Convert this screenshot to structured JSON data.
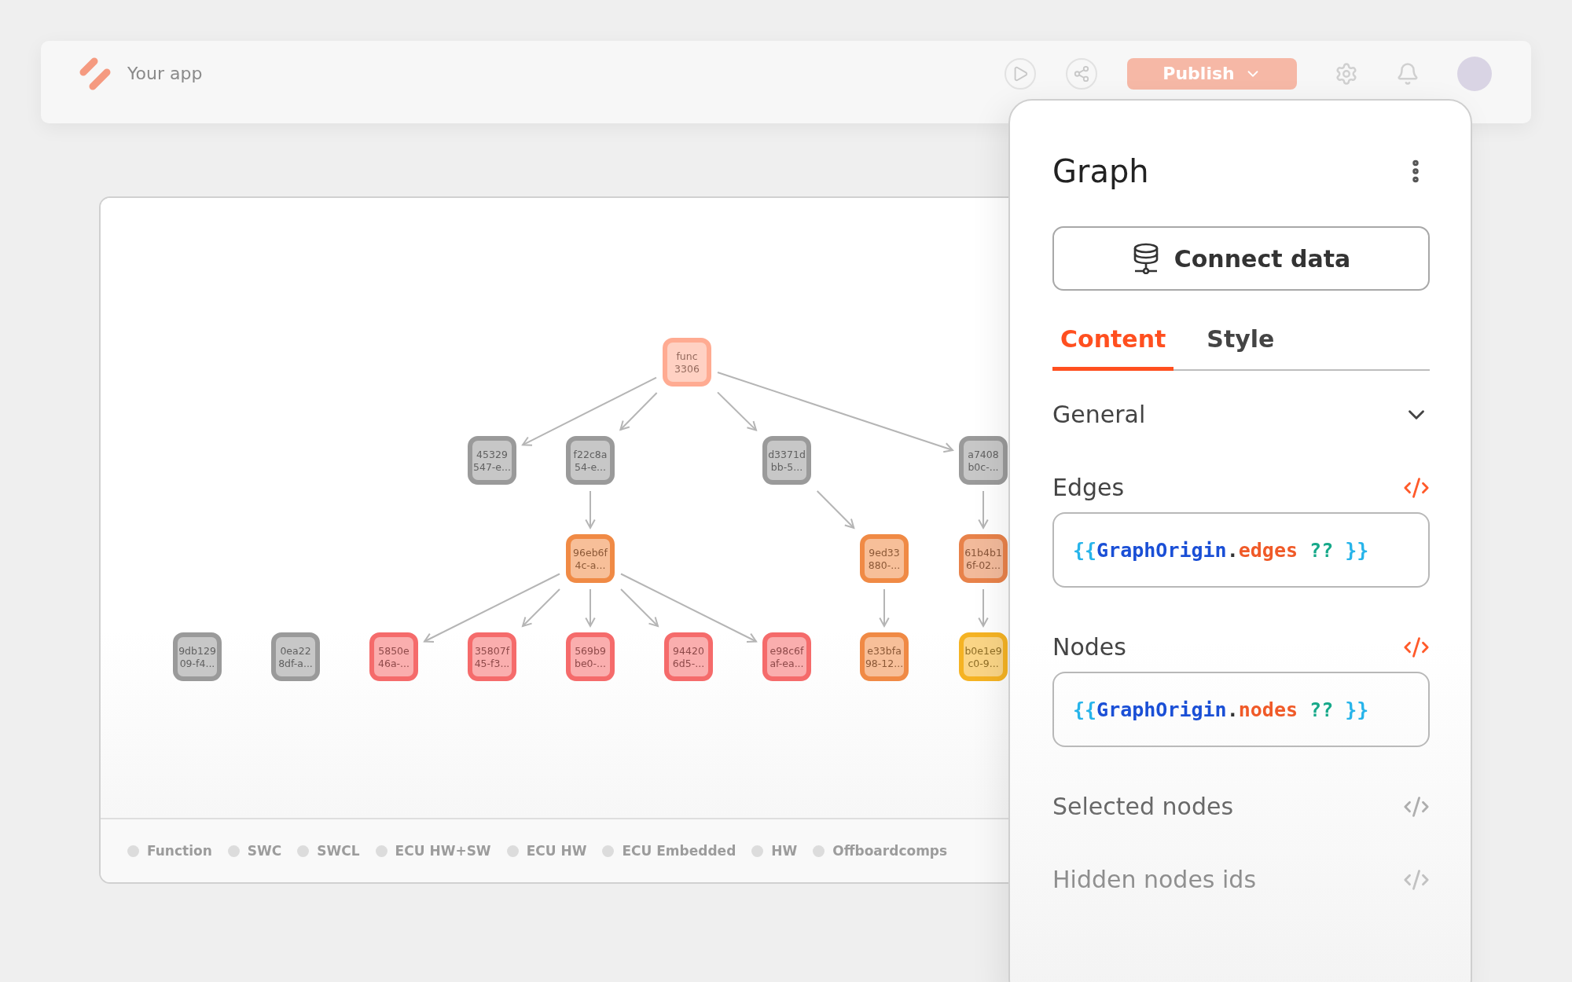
{
  "top_bar": {
    "app_name": "Your app",
    "publish_label": "Publish"
  },
  "graph": {
    "nodes": [
      {
        "lines": [
          "9db129",
          "09-f4..."
        ],
        "color": "#9a9a9a"
      },
      {
        "lines": [
          "0ea22",
          "8df-a..."
        ],
        "color": "#9a9a9a"
      },
      {
        "lines": [
          "func",
          "3306"
        ],
        "color": "#ffab92",
        "children": [
          {
            "lines": [
              "45329",
              "547-e..."
            ],
            "color": "#9a9a9a"
          },
          {
            "lines": [
              "f22c8a",
              "54-e..."
            ],
            "color": "#9a9a9a",
            "children": [
              {
                "lines": [
                  "96eb6f",
                  "4c-a..."
                ],
                "color": "#f08a45",
                "children": [
                  {
                    "lines": [
                      "5850e",
                      "46a-..."
                    ],
                    "color": "#f56b6b"
                  },
                  {
                    "lines": [
                      "35807f",
                      "45-f3..."
                    ],
                    "color": "#f56b6b"
                  },
                  {
                    "lines": [
                      "569b9",
                      "be0-..."
                    ],
                    "color": "#f56b6b"
                  },
                  {
                    "lines": [
                      "94420",
                      "6d5-..."
                    ],
                    "color": "#f56b6b"
                  },
                  {
                    "lines": [
                      "e98c6f",
                      "af-ea..."
                    ],
                    "color": "#f56b6b"
                  }
                ]
              }
            ]
          },
          {
            "lines": [
              "d3371d",
              "bb-5..."
            ],
            "color": "#9a9a9a",
            "children": [
              {
                "lines": [
                  "9ed33",
                  "880-..."
                ],
                "color": "#f08a45",
                "children": [
                  {
                    "lines": [
                      "e33bfa",
                      "98-12..."
                    ],
                    "color": "#f08a45"
                  }
                ]
              }
            ]
          },
          {
            "lines": [
              "a7408",
              "b0c-..."
            ],
            "color": "#9a9a9a",
            "children": [
              {
                "lines": [
                  "61b4b1",
                  "6f-02..."
                ],
                "color": "#e8824a",
                "children": [
                  {
                    "lines": [
                      "b0e1e9",
                      "c0-9..."
                    ],
                    "color": "#f5b323"
                  }
                ]
              }
            ]
          }
        ]
      }
    ],
    "legend": [
      {
        "label": "Function"
      },
      {
        "label": "SWC"
      },
      {
        "label": "SWCL"
      },
      {
        "label": "ECU HW+SW"
      },
      {
        "label": "ECU HW"
      },
      {
        "label": "ECU Embedded"
      },
      {
        "label": "HW"
      },
      {
        "label": "Offboardcomps"
      }
    ]
  },
  "panel": {
    "title": "Graph",
    "connect_label": "Connect data",
    "tabs": [
      {
        "label": "Content",
        "selected": true
      },
      {
        "label": "Style",
        "selected": false
      }
    ],
    "section": {
      "label": "General"
    },
    "properties": [
      {
        "kind": "field",
        "label": "Edges",
        "value": "{{GraphOrigin.edges ?? }}"
      },
      {
        "kind": "field",
        "label": "Nodes",
        "value": "{{GraphOrigin.nodes ?? }}"
      },
      {
        "kind": "label",
        "label": "Selected nodes"
      },
      {
        "kind": "label",
        "label": "Hidden nodes ids"
      }
    ]
  }
}
